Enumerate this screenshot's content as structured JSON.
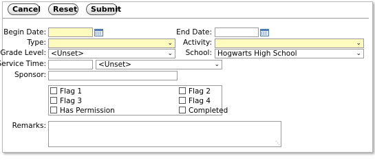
{
  "toolbar": {
    "cancel_label": "Cancel",
    "reset_label": "Reset",
    "submit_label": "Submit"
  },
  "form": {
    "begin_date": {
      "label": "Begin Date:",
      "value": ""
    },
    "end_date": {
      "label": "End Date:",
      "value": ""
    },
    "type": {
      "label": "Type:",
      "value": ""
    },
    "activity": {
      "label": "Activity:",
      "value": ""
    },
    "grade_level": {
      "label": "Grade Level:",
      "value": "<Unset>"
    },
    "school": {
      "label": "School:",
      "value": "Hogwarts High School"
    },
    "service_time": {
      "label": "Service Time:",
      "value": "",
      "unit_value": "<Unset>"
    },
    "sponsor": {
      "label": "Sponsor:",
      "value": ""
    },
    "flags": [
      {
        "label": "Flag 1",
        "checked": false
      },
      {
        "label": "Flag 2",
        "checked": false
      },
      {
        "label": "Flag 3",
        "checked": false
      },
      {
        "label": "Flag 4",
        "checked": false
      },
      {
        "label": "Has Permission",
        "checked": false
      },
      {
        "label": "Completed",
        "checked": false
      }
    ],
    "remarks": {
      "label": "Remarks:",
      "value": ""
    }
  },
  "icons": {
    "calendar": "calendar-icon",
    "dropdown": "chevron-down-icon",
    "resize": "resize-grip-icon"
  },
  "colors": {
    "required_field": "#fffbbf",
    "border": "#9a9a9a"
  }
}
